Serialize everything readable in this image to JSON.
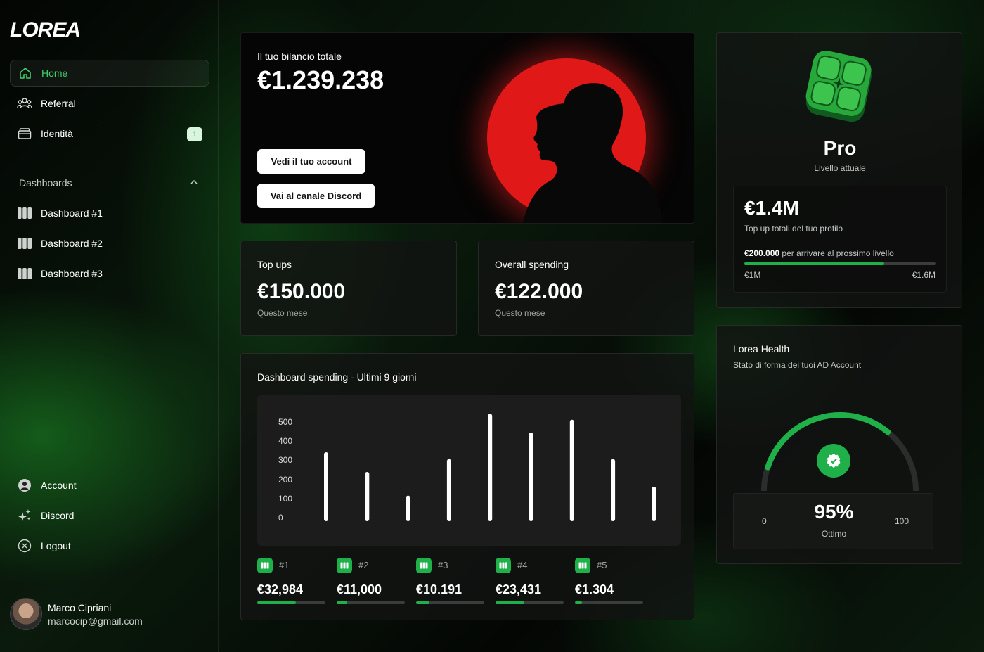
{
  "brand": {
    "logo": "LOREA"
  },
  "sidebar": {
    "items": [
      {
        "label": "Home",
        "icon": "home-icon"
      },
      {
        "label": "Referral",
        "icon": "users-icon"
      },
      {
        "label": "Identità",
        "icon": "wallet-icon",
        "badge": "1"
      }
    ],
    "section_label": "Dashboards",
    "dashboards": [
      {
        "label": "Dashboard #1"
      },
      {
        "label": "Dashboard #2"
      },
      {
        "label": "Dashboard #3"
      }
    ],
    "bottom": [
      {
        "label": "Account",
        "icon": "user-circle-icon"
      },
      {
        "label": "Discord",
        "icon": "sparkles-icon"
      },
      {
        "label": "Logout",
        "icon": "x-circle-icon"
      }
    ],
    "user": {
      "name": "Marco Cipriani",
      "email": "marcocip@gmail.com"
    }
  },
  "balance": {
    "label": "Il tuo bilancio totale",
    "value": "€1.239.238",
    "btn_account": "Vedi il tuo account",
    "btn_discord": "Vai al canale Discord"
  },
  "topups": {
    "title": "Top ups",
    "value": "€150.000",
    "sub": "Questo mese"
  },
  "spending": {
    "title": "Overall spending",
    "value": "€122.000",
    "sub": "Questo mese"
  },
  "level": {
    "name": "Pro",
    "sub": "Livello attuale",
    "total": "€1.4M",
    "total_label": "Top up totali del tuo profilo",
    "next_amount": "€200.000",
    "next_text": "per arrivare al prossimo livello",
    "min": "€1M",
    "max": "€1.6M",
    "progress": 0.73
  },
  "health": {
    "title": "Lorea Health",
    "sub": "Stato di forma dei tuoi AD Account",
    "value": "95%",
    "status": "Ottimo",
    "min": "0",
    "max": "100",
    "gauge_fraction": 0.95
  },
  "chart_data": {
    "type": "bar",
    "title": "Dashboard spending - Ultimi 9 giorni",
    "yticks": [
      "500",
      "400",
      "300",
      "200",
      "100",
      "0"
    ],
    "ylim": [
      0,
      500
    ],
    "values": [
      350,
      250,
      130,
      315,
      545,
      450,
      515,
      315,
      175
    ]
  },
  "accounts": [
    {
      "id": "#1",
      "value": "€32,984",
      "progress": 0.57
    },
    {
      "id": "#2",
      "value": "€11,000",
      "progress": 0.15
    },
    {
      "id": "#3",
      "value": "€10.191",
      "progress": 0.2
    },
    {
      "id": "#4",
      "value": "€23,431",
      "progress": 0.42
    },
    {
      "id": "#5",
      "value": "€1.304",
      "progress": 0.1
    }
  ],
  "colors": {
    "accent": "#1fb04a",
    "red_circle": "#e01818"
  }
}
